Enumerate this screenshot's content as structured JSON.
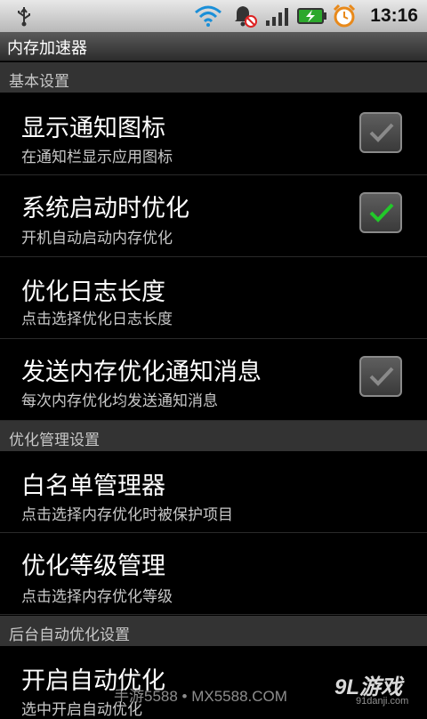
{
  "status_bar": {
    "time": "13:16",
    "icons": [
      "usb-icon",
      "wifi-icon",
      "alarm-muted-icon",
      "signal-icon",
      "battery-charging-icon",
      "alarm-clock-icon"
    ]
  },
  "app": {
    "title": "内存加速器"
  },
  "sections": {
    "basic": {
      "label": "基本设置"
    },
    "manage": {
      "label": "优化管理设置"
    },
    "auto": {
      "label": "后台自动优化设置"
    }
  },
  "items": {
    "show_icon": {
      "title": "显示通知图标",
      "summary": "在通知栏显示应用图标",
      "checked": true,
      "enabled": false
    },
    "boot_opt": {
      "title": "系统启动时优化",
      "summary": "开机自动启动内存优化",
      "checked": true,
      "enabled": true
    },
    "log_len": {
      "title": "优化日志长度",
      "summary": "点击选择优化日志长度"
    },
    "send_msg": {
      "title": "发送内存优化通知消息",
      "summary": "每次内存优化均发送通知消息",
      "checked": true,
      "enabled": false
    },
    "whitelist": {
      "title": "白名单管理器",
      "summary": "点击选择内存优化时被保护项目"
    },
    "level": {
      "title": "优化等级管理",
      "summary": "点击选择内存优化等级"
    },
    "auto_opt": {
      "title": "开启自动优化",
      "summary": "选中开启自动优化"
    }
  },
  "watermark": {
    "center": "手游5588 • MX5588.COM",
    "logo": "9L游戏",
    "logo_url": "91danji.com"
  },
  "colors": {
    "check_active": "#22c82a",
    "check_disabled": "#8a8a8a",
    "section_bg": "#333333"
  }
}
